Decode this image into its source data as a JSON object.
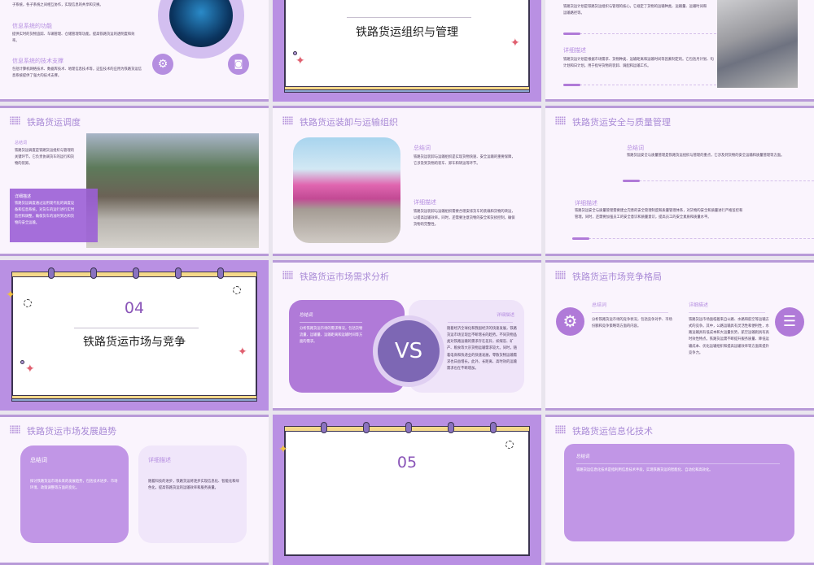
{
  "slides": {
    "info_system": {
      "intro_tail": "子系统，各子系统之间相互协作，实现信息的共享和交换。",
      "h1": "信息系统的功能",
      "t1": "提供实时的货物追踪、车辆管理、仓储管理等功能，提高铁路货运的透明度和效率。",
      "h2": "信息系统的技术支撑",
      "t2": "包括计算机网络技术、数据库技术、地理信息技术等，这些技术的应用为铁路货运信息系统提供了强大的技术支撑。"
    },
    "section03": {
      "title": "铁路货运组织与管理"
    },
    "plan": {
      "t1": "铁路货运计划是铁路货运组织与管理的核心，它规定了货物的运输种类、运输量、运输时间和运输路径等。",
      "h2": "详细描述",
      "t2": "铁路货运计划是根据市场需求、货物种类、运输距离和运输时间等因素制定的。它包括月计划、旬计划和日计划，用于指导货物的装卸、调配和运输工作。"
    },
    "dispatch": {
      "title": "铁路货运调度",
      "h1": "总结词",
      "t1": "铁路货运调度是铁路货运组织与管理的关键环节，它负责协调货车的运行和货物的装卸。",
      "h2": "详细描述",
      "t2": "铁路货运调度通过运用现代化的调度设备和信息系统，对货车的运行进行实时监控和调整，确保货车的准时到达和货物的安全运输。"
    },
    "loading": {
      "title": "铁路货运装卸与运输组织",
      "h1": "总结词",
      "t1": "铁路货运装卸与运输组织是实现货物快速、安全运输的重要保障，它涉及到货物的装车、卸车和转运等环节。",
      "h2": "详细描述",
      "t2": "铁路货运装卸与运输组织需要合理安排货车的装载和货物的转运，以提高运输效率。同时，还需要注意货物的安全和货损控制，确保货物的完整性。"
    },
    "safety": {
      "title": "铁路货运安全与质量管理",
      "h1": "总结词",
      "t1": "铁路货运安全与质量管理是铁路货运组织与管理的重点，它涉及到货物的安全运输和质量管理等方面。",
      "h2": "详细描述",
      "t2": "铁路货运安全与质量管理需要建立完善的安全管理制度和质量管理体系，对货物的安全和质量进行严格监控和管理。同时，还需要加强员工的安全意识和质量意识，提高员工的安全素质和质量水平。"
    },
    "section04": {
      "num": "04",
      "title": "铁路货运市场与竞争"
    },
    "demand": {
      "title": "铁路货运市场需求分析",
      "h1": "总结词",
      "t1": "分析铁路货运市场的需求情况，包括货物流量、运输量、运输距离和运输时间等方面的需求。",
      "vs": "VS",
      "h2": "详细描述",
      "t2": "随着经济全球化和我国经济的快速发展，铁路货运市场呈现出不断增长的趋势。不同货物品类对铁路运输的需求存在差异，如煤炭、矿产、粮食等大宗货物运输需求较大。同时，随着电商和快递业的快速发展，零散货物运输需求也日益增长。此外，长距离、高时效的运输需求也在不断增加。"
    },
    "competition": {
      "title": "铁路货运市场竞争格局",
      "h1": "总结词",
      "t1": "分析铁路货运市场的竞争状况，包括竞争对手、市场份额和竞争策略等方面的内容。",
      "h2": "详细描述",
      "t2": "铁路货运市场面临着来自公路、水路和航空等运输方式的竞争。其中，公路运输具有灵活性和便利性，水路运输具有低成本和大运量优势，航空运输则具有高时效性特点。铁路货运需不断提升服务质量、降低运输成本、优化运输组织和提高运输效率等方面来提升竞争力。"
    },
    "trend": {
      "title": "铁路货运市场发展趋势",
      "h1": "总结词",
      "t1": "探讨铁路货运市场未来的发展趋势，包括技术进步、市场环境、政策调整等方面的变化。",
      "h2": "详细描述",
      "t2": "随着科技的进步，铁路货运将逐步实现信息化、智能化和绿色化，提高铁路货运的运输效率和服务质量。"
    },
    "section05": {
      "num": "05"
    },
    "it": {
      "title": "铁路货运信息化技术",
      "h1": "总结词",
      "t1": "铁路货运信息化技术是指利用信息技术手段，实现铁路货运的智能化、自动化和高效化。"
    }
  },
  "colors": {
    "accent": "#b07ad8",
    "bg": "#faf4fd",
    "section_bg": "#b990e3"
  }
}
